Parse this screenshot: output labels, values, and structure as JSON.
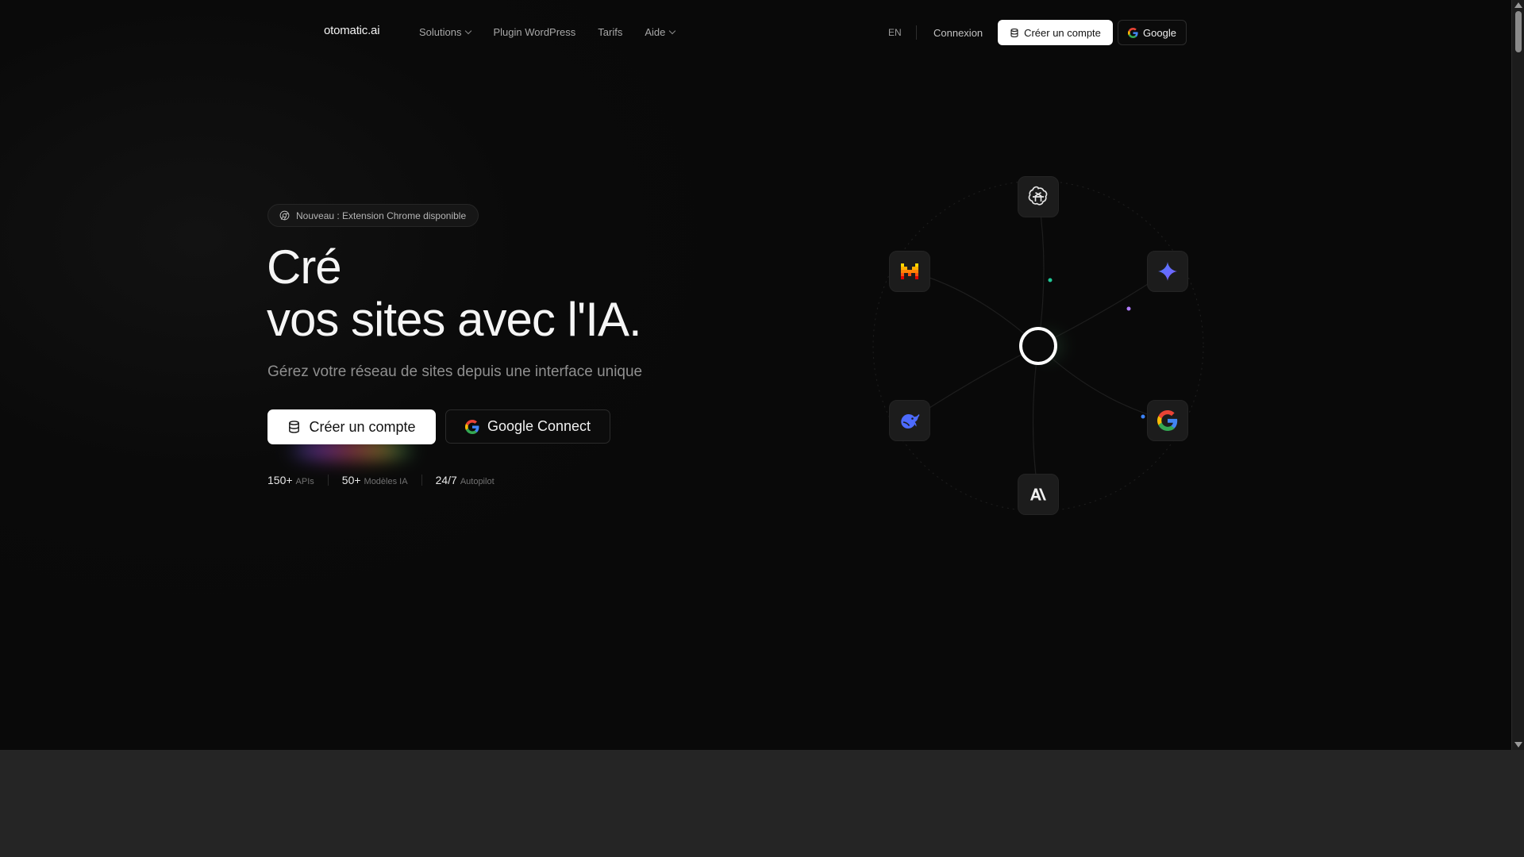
{
  "nav": {
    "logo": "otomatic.ai",
    "items": [
      {
        "label": "Solutions",
        "dropdown": true
      },
      {
        "label": "Plugin WordPress",
        "dropdown": false
      },
      {
        "label": "Tarifs",
        "dropdown": false
      },
      {
        "label": "Aide",
        "dropdown": true
      }
    ],
    "lang": "EN",
    "login": "Connexion",
    "create_account": "Créer un compte",
    "google": "Google"
  },
  "hero": {
    "badge": "Nouveau : Extension Chrome disponible",
    "title_line1": "Cré",
    "title_line2": "vos sites avec l'IA.",
    "subtitle": "Gérez votre réseau de sites depuis une interface unique",
    "cta_primary": "Créer un compte",
    "cta_google": "Google Connect",
    "stats": [
      {
        "num": "150+",
        "label": "APIs"
      },
      {
        "num": "50+",
        "label": "Modèles IA"
      },
      {
        "num": "24/7",
        "label": "Autopilot"
      }
    ]
  },
  "orbit": {
    "nodes": [
      "openai-icon",
      "gemini-icon",
      "google-icon",
      "anthropic-icon",
      "deepseek-icon",
      "mistral-icon"
    ]
  },
  "colors": {
    "background": "#0a0a0a",
    "button_primary": "#ffffff",
    "google_blue": "#4285F4",
    "google_red": "#EA4335",
    "google_yellow": "#FBBC05",
    "google_green": "#34A853"
  }
}
